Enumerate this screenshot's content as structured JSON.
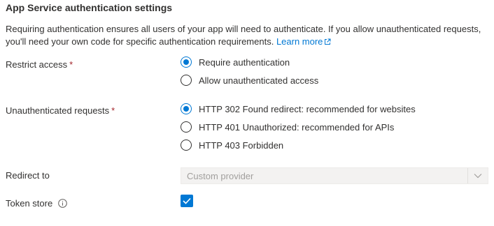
{
  "section": {
    "title": "App Service authentication settings",
    "description": "Requiring authentication ensures all users of your app will need to authenticate. If you allow unauthenticated requests, you'll need your own code for specific authentication requirements.",
    "learn_more": "Learn more",
    "learn_more_icon": "external-link-icon"
  },
  "restrict_access": {
    "label": "Restrict access",
    "required_mark": "*",
    "options": [
      {
        "label": "Require authentication",
        "checked": true
      },
      {
        "label": "Allow unauthenticated access",
        "checked": false
      }
    ]
  },
  "unauthenticated_requests": {
    "label": "Unauthenticated requests",
    "required_mark": "*",
    "options": [
      {
        "label": "HTTP 302 Found redirect: recommended for websites",
        "checked": true
      },
      {
        "label": "HTTP 401 Unauthorized: recommended for APIs",
        "checked": false
      },
      {
        "label": "HTTP 403 Forbidden",
        "checked": false
      }
    ]
  },
  "redirect_to": {
    "label": "Redirect to",
    "selected_value": "Custom provider",
    "disabled": true
  },
  "token_store": {
    "label": "Token store",
    "info_icon": "info-icon",
    "checked": true
  },
  "colors": {
    "accent": "#0078d4",
    "text": "#323130",
    "required": "#a4262c",
    "disabled_text": "#a19f9d",
    "disabled_bg": "#f3f2f1"
  }
}
